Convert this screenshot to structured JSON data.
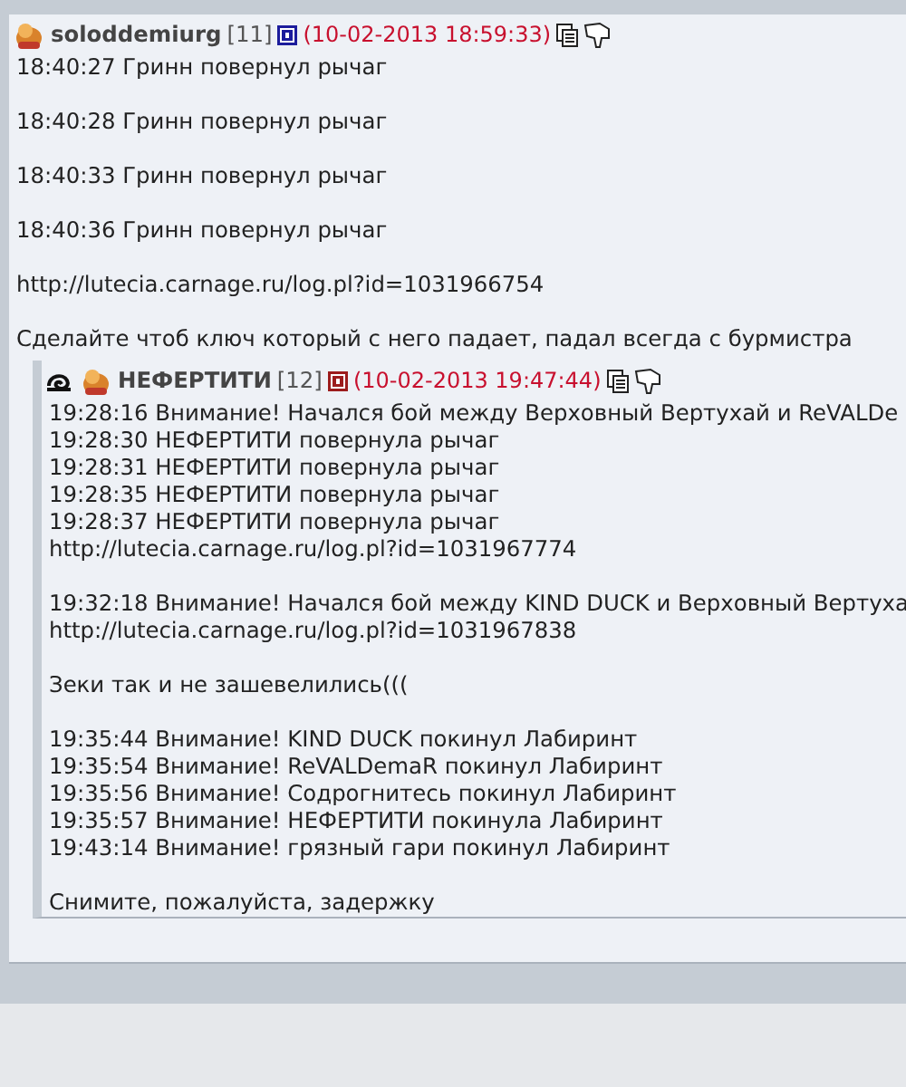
{
  "posts": [
    {
      "author": "soloddemiurg",
      "rank": "[11]",
      "color": "#1c1c9c",
      "date": "(10-02-2013 18:59:33)",
      "clan_sign": false,
      "paragraphs": [
        [
          "18:40:27 Гринн повернул рычаг"
        ],
        [
          "18:40:28 Гринн повернул рычаг"
        ],
        [
          "18:40:33 Гринн повернул рычаг"
        ],
        [
          "18:40:36 Гринн повернул рычаг"
        ],
        [
          "http://lutecia.carnage.ru/log.pl?id=1031966754"
        ],
        [
          "Сделайте чтоб ключ который с него падает, падал всегда с бурмистра"
        ]
      ],
      "children": [
        {
          "author": "НЕФЕРТИТИ",
          "rank": "[12]",
          "color": "#9c1c1c",
          "date": "(10-02-2013 19:47:44)",
          "clan_sign": true,
          "paragraphs": [
            [
              "19:28:16 Внимание! Начался бой между Верховный Вертухай и ReVALDe",
              "19:28:30 НЕФЕРТИТИ повернула рычаг",
              "19:28:31 НЕФЕРТИТИ повернула рычаг",
              "19:28:35 НЕФЕРТИТИ повернула рычаг",
              "19:28:37 НЕФЕРТИТИ повернула рычаг",
              "http://lutecia.carnage.ru/log.pl?id=1031967774"
            ],
            [
              "19:32:18 Внимание! Начался бой между KIND DUCK и Верховный Вертуха",
              "http://lutecia.carnage.ru/log.pl?id=1031967838"
            ],
            [
              "Зеки так и не зашевелились((("
            ],
            [
              "19:35:44 Внимание! KIND DUCK покинул Лабиринт",
              "19:35:54 Внимание! ReVALDemaR покинул Лабиринт",
              "19:35:56 Внимание! Содрогнитесь покинул Лабиринт",
              "19:35:57 Внимание! НЕФЕРТИТИ покинула Лабиринт",
              "19:43:14 Внимание! грязный гари покинул Лабиринт"
            ],
            [
              "Снимите, пожалуйста, задержку"
            ]
          ]
        }
      ]
    }
  ]
}
